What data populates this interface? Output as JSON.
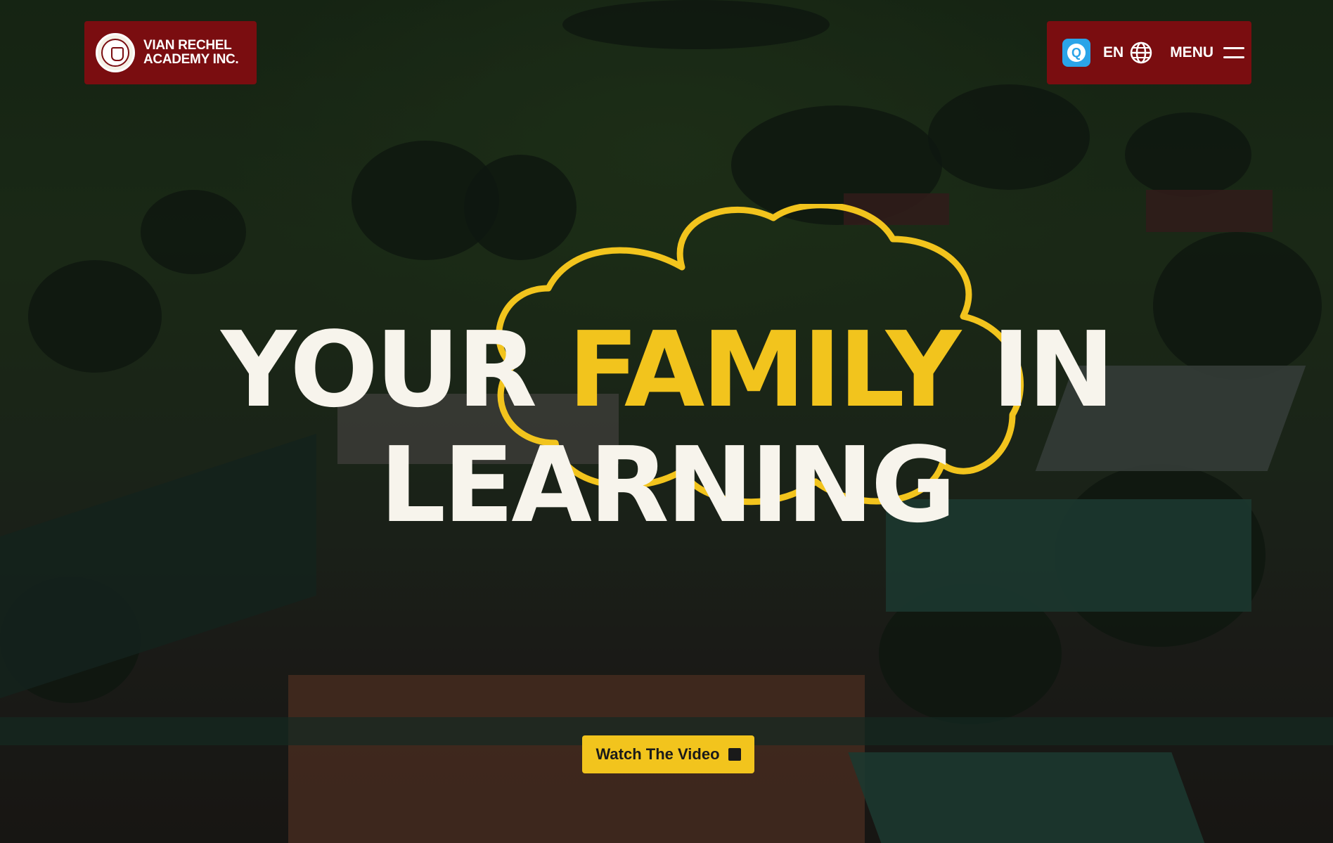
{
  "brand": {
    "name_line1": "VIAN RECHEL",
    "name_line2": "ACADEMY INC.",
    "logo_icon": "school-seal-icon",
    "color": "#7a0d10"
  },
  "nav": {
    "search_icon": "q-app-icon",
    "language": "EN",
    "language_icon": "globe-icon",
    "menu_label": "MENU",
    "menu_icon": "hamburger-icon"
  },
  "hero": {
    "word_your": "YOUR",
    "word_family": "FAMILY",
    "word_in": "IN",
    "word_learning": "LEARNING",
    "accent_color": "#f2c41d",
    "text_color": "#f7f4ec"
  },
  "cta": {
    "label": "Watch The Video",
    "icon": "stop-square-icon"
  }
}
